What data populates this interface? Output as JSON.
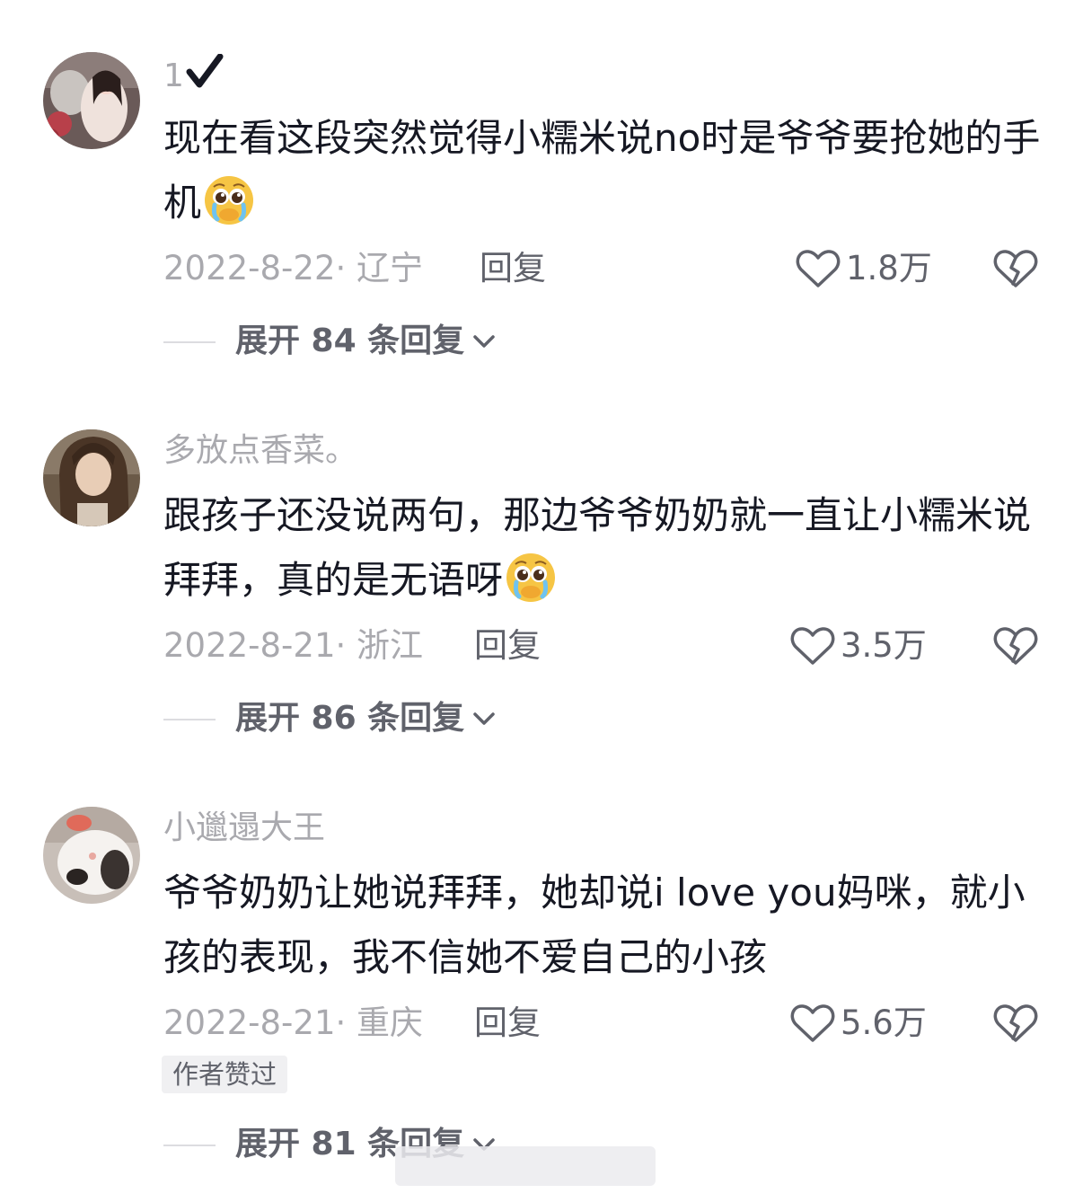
{
  "comments": [
    {
      "username": "1",
      "text": "现在看这段突然觉得小糯米说no时是爷爷要抢她的手机",
      "emoji": "pleading-crying-face-emoji",
      "date_location": "2022-8-22· 辽宁",
      "reply_label": "回复",
      "likes": "1.8万",
      "expand_label": "展开 84 条回复"
    },
    {
      "username": "多放点香菜。",
      "text": "跟孩子还没说两句，那边爷爷奶奶就一直让小糯米说拜拜，真的是无语呀",
      "emoji": "pleading-crying-face-emoji",
      "date_location": "2022-8-21· 浙江",
      "reply_label": "回复",
      "likes": "3.5万",
      "expand_label": "展开 86 条回复"
    },
    {
      "username": "小邋遢大王",
      "text": "爷爷奶奶让她说拜拜，她却说i love you妈咪，就小孩的表现，我不信她不爱自己的小孩",
      "date_location": "2022-8-21· 重庆",
      "reply_label": "回复",
      "likes": "5.6万",
      "badge": "作者赞过",
      "expand_label": "展开 81 条回复"
    }
  ],
  "colors": {
    "text_primary": "#161823",
    "text_secondary": "#a9a9ae",
    "text_action": "#60626b"
  }
}
